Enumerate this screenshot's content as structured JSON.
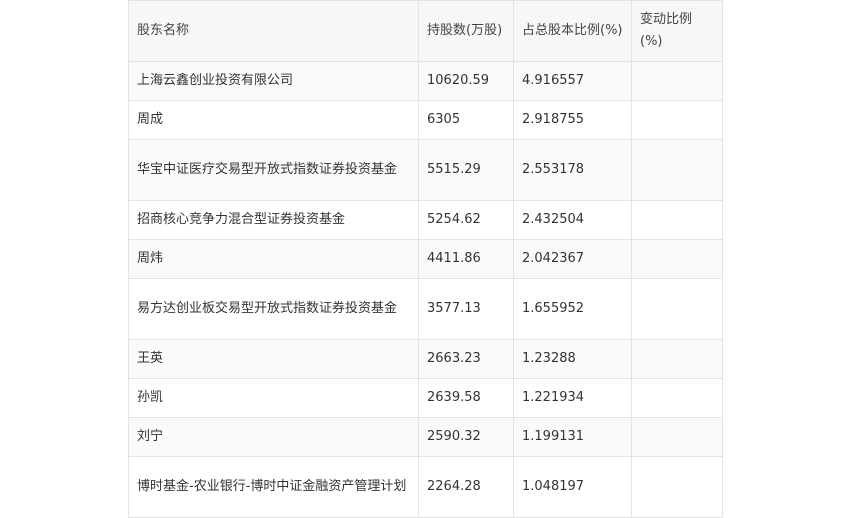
{
  "headers": [
    "股东名称",
    "持股数(万股)",
    "占总股本比例(%)",
    "变动比例(%)"
  ],
  "rows": [
    {
      "name": "上海云鑫创业投资有限公司",
      "shares": "10620.59",
      "ratio": "4.916557",
      "change": ""
    },
    {
      "name": "周成",
      "shares": "6305",
      "ratio": "2.918755",
      "change": ""
    },
    {
      "name": "华宝中证医疗交易型开放式指数证券投资基金",
      "shares": "5515.29",
      "ratio": "2.553178",
      "change": ""
    },
    {
      "name": "招商核心竞争力混合型证券投资基金",
      "shares": "5254.62",
      "ratio": "2.432504",
      "change": ""
    },
    {
      "name": "周炜",
      "shares": "4411.86",
      "ratio": "2.042367",
      "change": ""
    },
    {
      "name": "易方达创业板交易型开放式指数证券投资基金",
      "shares": "3577.13",
      "ratio": "1.655952",
      "change": ""
    },
    {
      "name": "王英",
      "shares": "2663.23",
      "ratio": "1.23288",
      "change": ""
    },
    {
      "name": "孙凯",
      "shares": "2639.58",
      "ratio": "1.221934",
      "change": ""
    },
    {
      "name": "刘宁",
      "shares": "2590.32",
      "ratio": "1.199131",
      "change": ""
    },
    {
      "name": "博时基金-农业银行-博时中证金融资产管理计划",
      "shares": "2264.28",
      "ratio": "1.048197",
      "change": ""
    }
  ]
}
